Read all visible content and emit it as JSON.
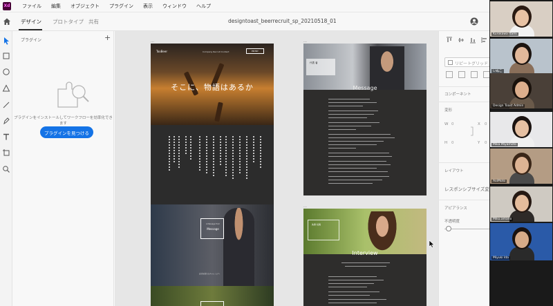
{
  "app": {
    "logo_text": "Xd",
    "menu": [
      "ファイル",
      "編集",
      "オブジェクト",
      "プラグイン",
      "表示",
      "ウィンドウ",
      "ヘルプ"
    ]
  },
  "tabs": [
    {
      "label": "デザイン",
      "active": true
    },
    {
      "label": "プロトタイプ",
      "active": false
    },
    {
      "label": "共有",
      "active": false
    }
  ],
  "document": {
    "title": "designtoast_beerrecruit_sp_20210518_01"
  },
  "plugins": {
    "title": "プラグイン",
    "add": "+",
    "message": "プラグインをインストールしてワークフローを効率化できます",
    "button": "プラグインを見つける"
  },
  "artboards": {
    "a1": {
      "logo": "TooBeer",
      "links": "Company  Recruit  Contact",
      "nav_button": "ENTRY",
      "headline": "そこに、物語はあるか",
      "message_sub": "A Message from",
      "message_label": "Message",
      "message_caption": "会社を変えるチャレンジへ"
    },
    "a2": {
      "box_label": "代表 者",
      "section": "Message"
    },
    "a3": {
      "box_label": "先輩 社員",
      "section": "Interview"
    }
  },
  "properties": {
    "repeat_grid": "リピートグリッド",
    "component": "コンポーネント",
    "transform": "変形",
    "w_label": "W",
    "w_value": "0",
    "x_label": "X",
    "x_value": "0",
    "h_label": "H",
    "h_value": "0",
    "y_label": "Y",
    "y_value": "0",
    "layout": "レイアウト",
    "responsive": "レスポンシブサイズ変更",
    "appearance": "アピアランス",
    "opacity": "不透明度"
  },
  "participants": [
    {
      "name": "Kurokawa Itami",
      "bg": "#d9cfc4",
      "skin": "#e8c2a4",
      "hair": "#2a1a12",
      "shirt": "#f2f2f2"
    },
    {
      "name": "いぬこ",
      "bg": "#b9c3cc",
      "skin": "#e2b89a",
      "hair": "#1c1410",
      "shirt": "#8a6f5a"
    },
    {
      "name": "Design Toast Admin",
      "bg": "#4a4038",
      "skin": "#dcae8c",
      "hair": "#1a120c",
      "shirt": "#6a5a4a"
    },
    {
      "name": "Mika Miyamoto",
      "bg": "#e8e8ea",
      "skin": "#e6c0a2",
      "hair": "#1b1310",
      "shirt": "#f0f0f0"
    },
    {
      "name": "AoiMoto",
      "bg": "#b49c84",
      "skin": "#deb494",
      "hair": "#3a2618",
      "shirt": "#4a4a4a"
    },
    {
      "name": "Miku.amano",
      "bg": "#cfcac2",
      "skin": "#e4bc9c",
      "hair": "#251812",
      "shirt": "#2e2a28"
    },
    {
      "name": "Miyuki Ida",
      "bg": "#2a5aa8",
      "skin": "#d6aa88",
      "hair": "#1a1210",
      "shirt": "#2a2a2a"
    }
  ]
}
